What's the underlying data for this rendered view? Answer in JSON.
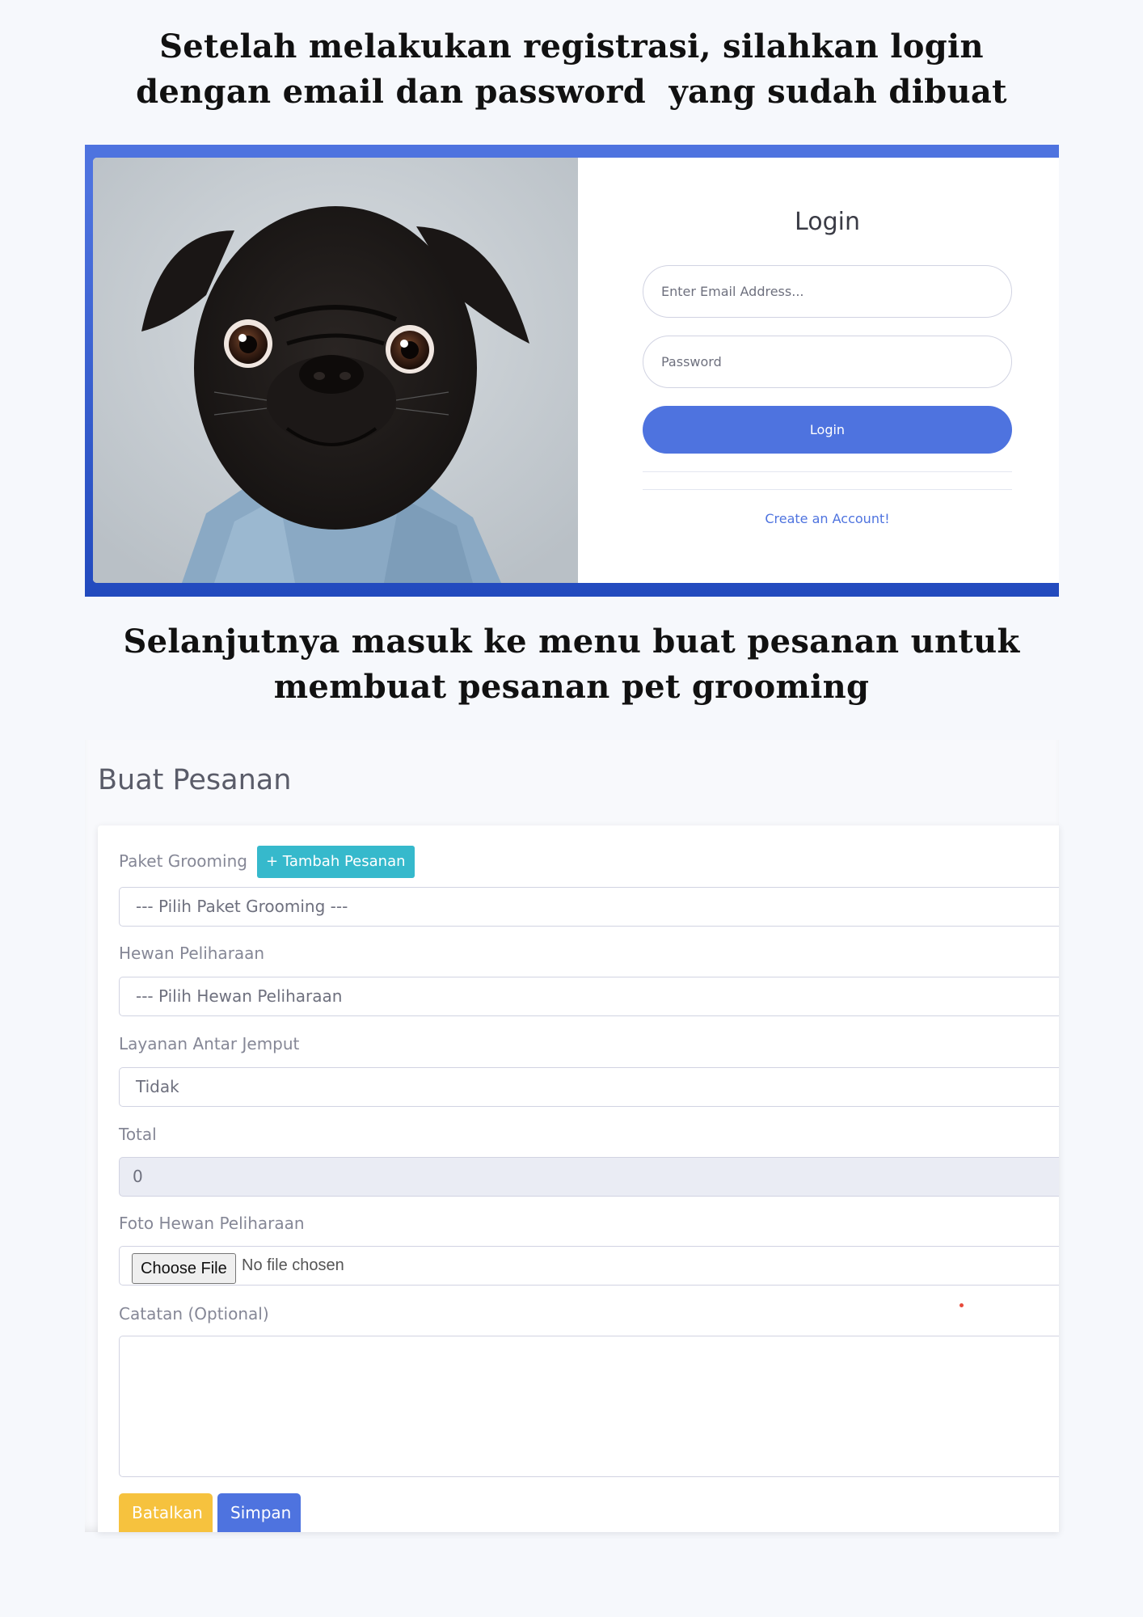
{
  "heading_login": {
    "line1": "Setelah melakukan registrasi, silahkan login",
    "line2": "dengan email dan password  yang sudah dibuat"
  },
  "login": {
    "title": "Login",
    "email_placeholder": "Enter Email Address...",
    "password_placeholder": "Password",
    "button_label": "Login",
    "create_account_link": "Create an Account!",
    "photo_subject": "pug-dog-photo"
  },
  "heading_order": {
    "line1": "Selanjutnya masuk ke menu buat pesanan untuk",
    "line2": "membuat pesanan pet grooming"
  },
  "order_form": {
    "page_title": "Buat Pesanan",
    "paket_label": "Paket Grooming",
    "tambah_button": "+ Tambah Pesanan",
    "paket_value": "--- Pilih Paket Grooming ---",
    "hewan_label": "Hewan Peliharaan",
    "hewan_value": "--- Pilih Hewan Peliharaan",
    "antar_label": "Layanan Antar Jemput",
    "antar_value": "Tidak",
    "total_label": "Total",
    "total_value": "0",
    "foto_label": "Foto Hewan Peliharaan",
    "choose_file_button": "Choose File",
    "no_file_text": "No file chosen",
    "catatan_label": "Catatan (Optional)",
    "catatan_value": "",
    "batal_button": "Batalkan",
    "simpan_button": "Simpan"
  },
  "colors": {
    "primary": "#4e73df",
    "info": "#36b9cc",
    "warning": "#f6c23e",
    "page_bg": "#f6f8fc"
  }
}
